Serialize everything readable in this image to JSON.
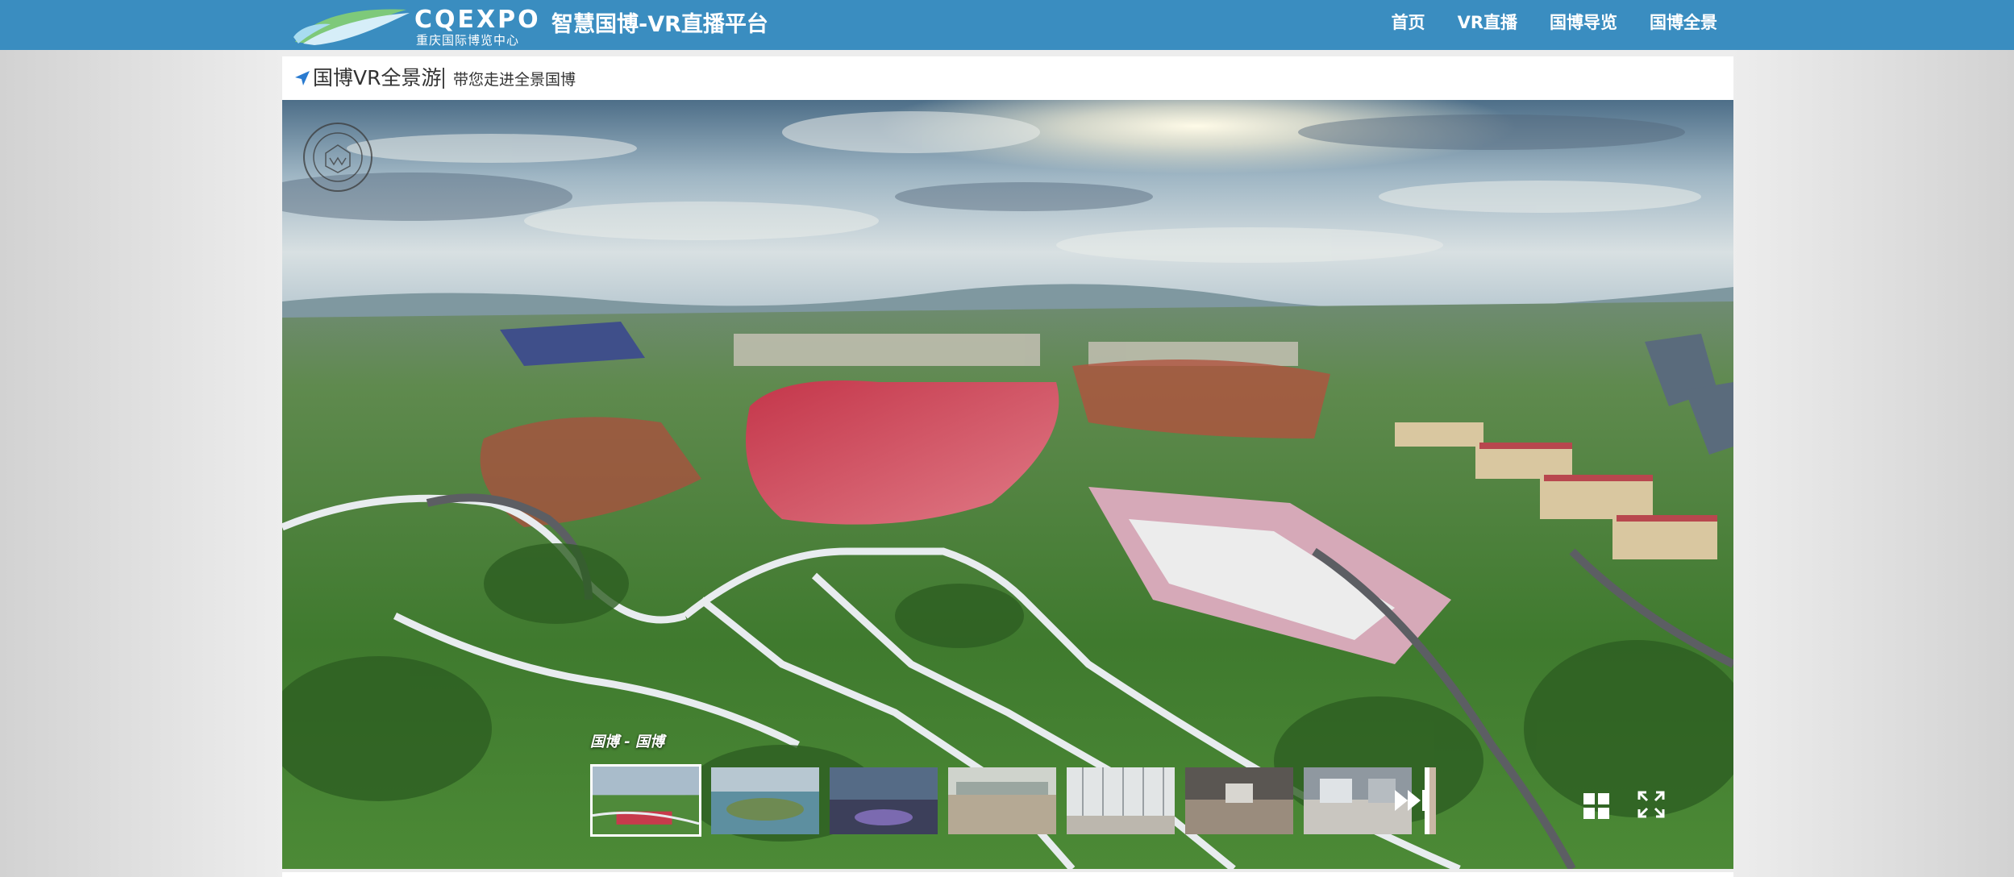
{
  "header": {
    "logo_word": "CQEXPO",
    "logo_sub": "重庆国际博览中心",
    "site_title": "智慧国博-VR直播平台",
    "nav": [
      "首页",
      "VR直播",
      "国博导览",
      "国博全景"
    ]
  },
  "panel": {
    "title": "国博VR全景游",
    "subtitle": "带您走进全景国博"
  },
  "viewer": {
    "scene_label": "国博 - 国博",
    "thumbnails": [
      {
        "name": "aerial-red-field",
        "active": true
      },
      {
        "name": "river-island"
      },
      {
        "name": "dusk-lights"
      },
      {
        "name": "empty-hall-floor"
      },
      {
        "name": "glass-hall"
      },
      {
        "name": "warehouse-interior"
      },
      {
        "name": "exhibition-corridor"
      }
    ]
  },
  "icons": {
    "nav_arrow": "location-arrow-icon",
    "watermark": "university-seal-icon",
    "next": "double-chevron-right-icon",
    "grid": "grid-icon",
    "fullscreen": "fullscreen-icon"
  },
  "colors": {
    "header_bg": "#3a8dc0",
    "accent_arrow": "#2a7bd0"
  }
}
